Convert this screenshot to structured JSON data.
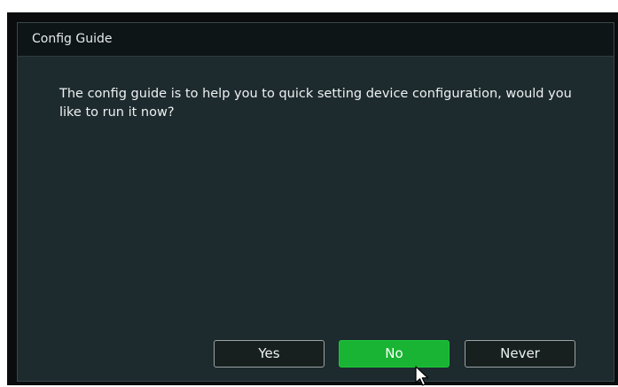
{
  "dialog": {
    "title": "Config Guide",
    "message": "The config guide is to help you to quick setting device configuration, would you like to run it now?"
  },
  "buttons": {
    "yes_label": "Yes",
    "no_label": "No",
    "never_label": "Never"
  },
  "colors": {
    "selected_button": "#19b433",
    "dialog_background": "#1d2a2e",
    "titlebar_background": "#0e1517"
  },
  "icons": {
    "pointer": "mouse-pointer-icon"
  }
}
